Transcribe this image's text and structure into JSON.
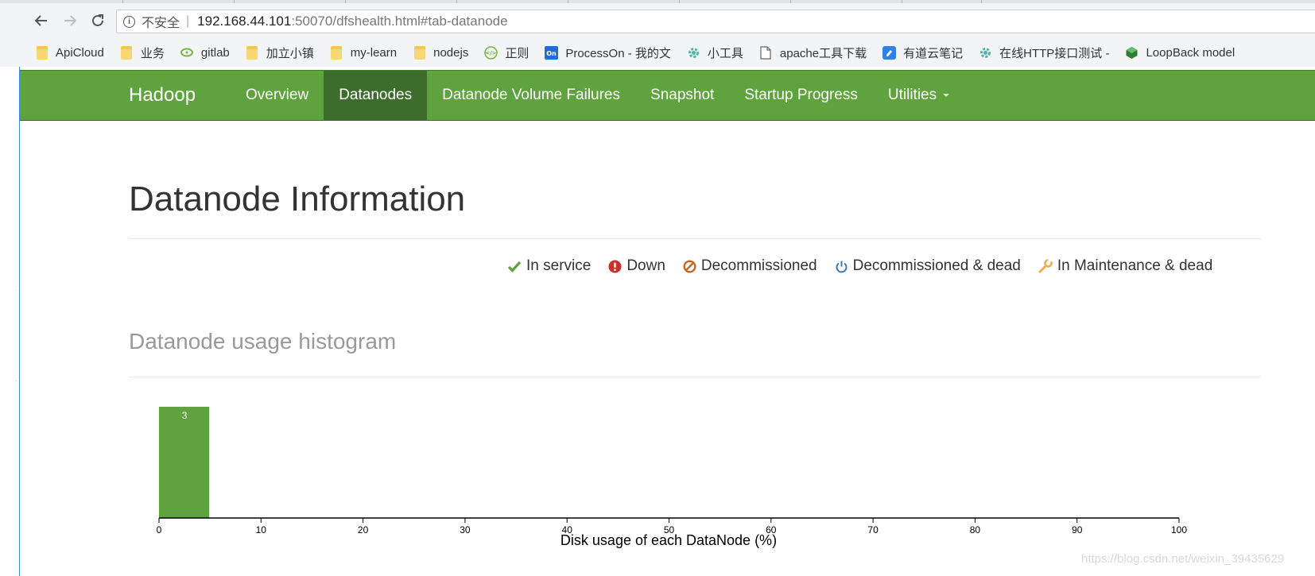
{
  "browser": {
    "insecure_label": "不安全",
    "url_host": "192.168.44.101",
    "url_rest": ":50070/dfshealth.html#tab-datanode",
    "bookmarks": [
      {
        "label": "ApiCloud",
        "icon": "folder-icon"
      },
      {
        "label": "业务",
        "icon": "folder-icon"
      },
      {
        "label": "gitlab",
        "icon": "gitlab-icon"
      },
      {
        "label": "加立小镇",
        "icon": "folder-icon"
      },
      {
        "label": "my-learn",
        "icon": "folder-icon"
      },
      {
        "label": "nodejs",
        "icon": "folder-icon"
      },
      {
        "label": "正则",
        "icon": "regex-icon"
      },
      {
        "label": "ProcessOn - 我的文",
        "icon": "processon-icon"
      },
      {
        "label": "小工具",
        "icon": "gear-icon"
      },
      {
        "label": "apache工具下载",
        "icon": "page-icon"
      },
      {
        "label": "有道云笔记",
        "icon": "note-icon"
      },
      {
        "label": "在线HTTP接口测试 -",
        "icon": "gear-icon"
      },
      {
        "label": "LoopBack model",
        "icon": "cube-icon"
      }
    ]
  },
  "navbar": {
    "brand": "Hadoop",
    "items": [
      {
        "label": "Overview",
        "active": false
      },
      {
        "label": "Datanodes",
        "active": true
      },
      {
        "label": "Datanode Volume Failures",
        "active": false
      },
      {
        "label": "Snapshot",
        "active": false
      },
      {
        "label": "Startup Progress",
        "active": false
      },
      {
        "label": "Utilities",
        "active": false,
        "dropdown": true
      }
    ],
    "colors": {
      "bar": "#5fa33e",
      "active": "#3d6d2c"
    }
  },
  "page": {
    "title": "Datanode Information",
    "legend": [
      {
        "label": "In service",
        "icon": "check-icon",
        "color": "#5fa33e"
      },
      {
        "label": "Down",
        "icon": "exclamation-circle-icon",
        "color": "#c9302c"
      },
      {
        "label": "Decommissioned",
        "icon": "ban-icon",
        "color": "#c8641e"
      },
      {
        "label": "Decommissioned & dead",
        "icon": "power-icon",
        "color": "#3a76b4"
      },
      {
        "label": "In Maintenance & dead",
        "icon": "wrench-icon",
        "color": "#f0ad4e"
      }
    ],
    "histogram_title": "Datanode usage histogram"
  },
  "chart_data": {
    "type": "bar",
    "title": "",
    "xlabel": "Disk usage of each DataNode (%)",
    "ylabel": "",
    "xlim": [
      0,
      100
    ],
    "x_ticks": [
      0,
      10,
      20,
      30,
      40,
      50,
      60,
      70,
      80,
      90,
      100
    ],
    "bins": [
      {
        "x0": 0,
        "x1": 5,
        "count": 3
      }
    ],
    "bar_color": "#5fa33e"
  },
  "watermark": "https://blog.csdn.net/weixin_39435629"
}
